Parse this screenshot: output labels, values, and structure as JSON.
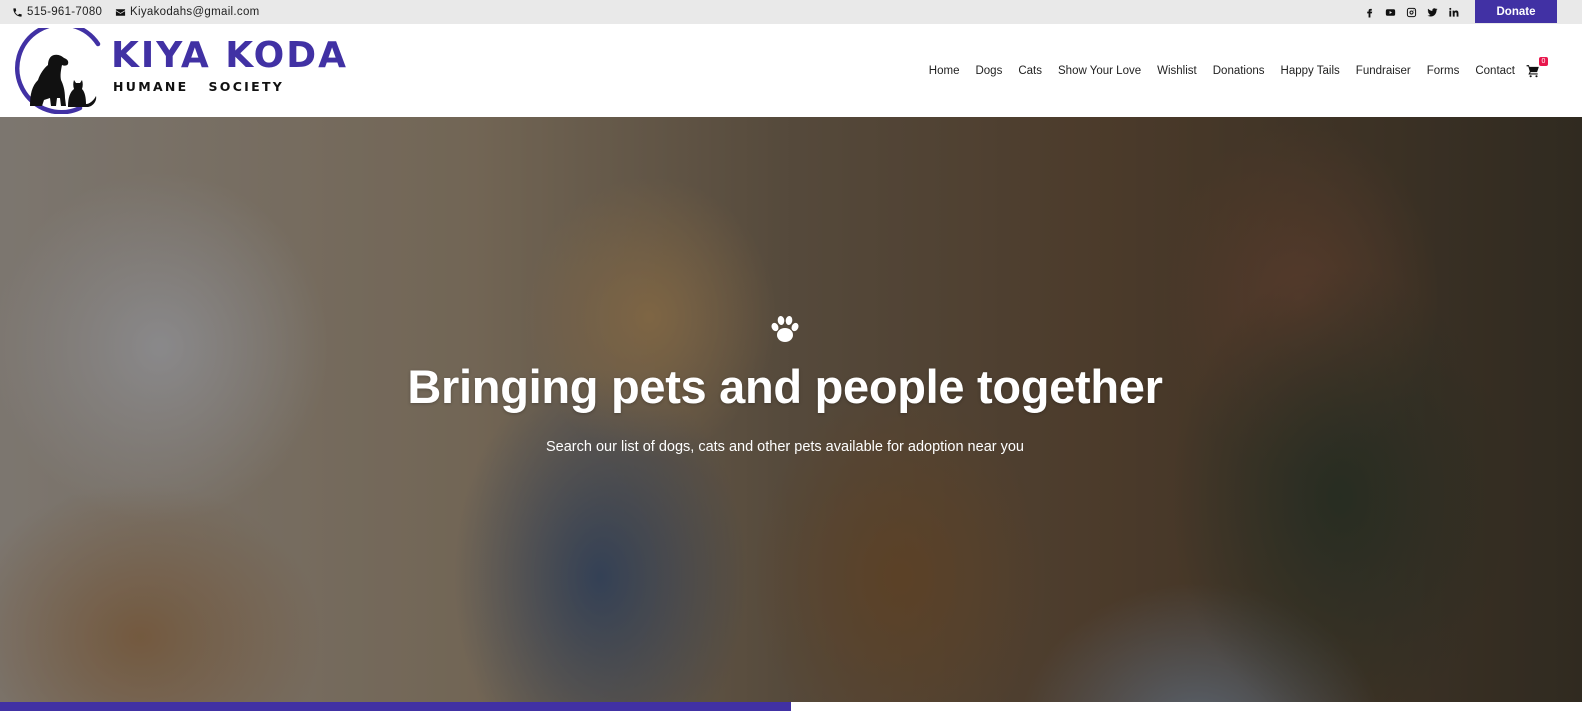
{
  "topbar": {
    "phone": "515-961-7080",
    "email": "Kiyakodahs@gmail.com",
    "phone_icon": "phone-icon",
    "email_icon": "envelope-icon",
    "socials": [
      "facebook-icon",
      "youtube-icon",
      "instagram-icon",
      "twitter-icon",
      "linkedin-icon"
    ],
    "donate_label": "Donate"
  },
  "header": {
    "logo_title": "KIYA KODA",
    "logo_subtitle": "HUMANE   SOCIETY",
    "logo_icon": "dog-and-cat-logo"
  },
  "nav": {
    "items": [
      "Home",
      "Dogs",
      "Cats",
      "Show Your Love",
      "Wishlist",
      "Donations",
      "Happy Tails",
      "Fundraiser",
      "Forms",
      "Contact"
    ],
    "cart_icon": "cart-icon",
    "cart_count": "0"
  },
  "hero": {
    "icon": "paw-icon",
    "title": "Bringing pets and people together",
    "subtitle": "Search our list of dogs, cats and other pets available for adoption near you"
  },
  "slider": {
    "progress": 0.5
  },
  "colors": {
    "brand": "#4131a4",
    "badge": "#e8174d",
    "topbar_bg": "#e9e9e9"
  }
}
